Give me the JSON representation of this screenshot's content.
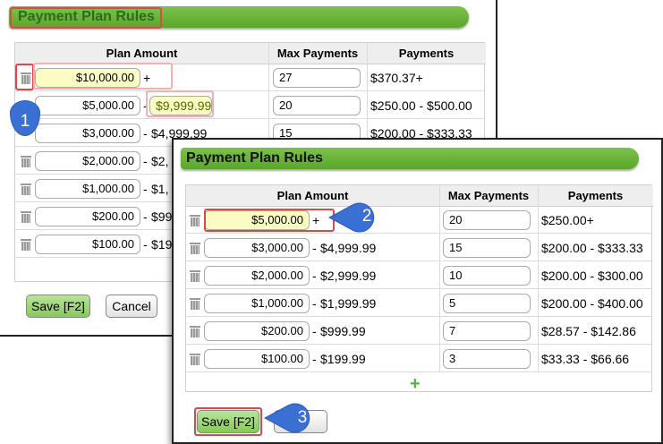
{
  "panel1": {
    "title": "Payment Plan Rules",
    "headers": [
      "Plan Amount",
      "Max Payments",
      "Payments"
    ],
    "rows": [
      {
        "from": "$10,000.00",
        "sep": "+",
        "to": "",
        "max": "27",
        "payments": "$370.37+"
      },
      {
        "from": "$5,000.00",
        "sep": "-",
        "to": "$9,999.99",
        "max": "20",
        "payments": "$250.00 - $500.00"
      },
      {
        "from": "$3,000.00",
        "sep": "-",
        "to": "$4,999.99",
        "max": "15",
        "payments": "$200.00 - $333.33"
      },
      {
        "from": "$2,000.00",
        "sep": "-",
        "to": "$2,",
        "max": "",
        "payments": ""
      },
      {
        "from": "$1,000.00",
        "sep": "-",
        "to": "$1,",
        "max": "",
        "payments": ""
      },
      {
        "from": "$200.00",
        "sep": "-",
        "to": "$99",
        "max": "",
        "payments": ""
      },
      {
        "from": "$100.00",
        "sep": "-",
        "to": "$19",
        "max": "",
        "payments": ""
      }
    ],
    "save_label": "Save [F2]",
    "cancel_label": "Cancel"
  },
  "panel2": {
    "title": "Payment Plan Rules",
    "headers": [
      "Plan Amount",
      "Max Payments",
      "Payments"
    ],
    "rows": [
      {
        "from": "$5,000.00",
        "sep": "+",
        "to": "",
        "max": "20",
        "payments": "$250.00+"
      },
      {
        "from": "$3,000.00",
        "sep": "-",
        "to": "$4,999.99",
        "max": "15",
        "payments": "$200.00 - $333.33"
      },
      {
        "from": "$2,000.00",
        "sep": "-",
        "to": "$2,999.99",
        "max": "10",
        "payments": "$200.00 - $300.00"
      },
      {
        "from": "$1,000.00",
        "sep": "-",
        "to": "$1,999.99",
        "max": "5",
        "payments": "$200.00 - $400.00"
      },
      {
        "from": "$200.00",
        "sep": "-",
        "to": "$999.99",
        "max": "7",
        "payments": "$28.57 - $142.86"
      },
      {
        "from": "$100.00",
        "sep": "-",
        "to": "$199.99",
        "max": "3",
        "payments": "$33.33 - $66.66"
      }
    ],
    "add_icon": "plus-icon",
    "save_label": "Save [F2]"
  },
  "callouts": [
    "1",
    "2",
    "3"
  ],
  "colors": {
    "title_green": "#5aa62b",
    "highlight": "#e04848",
    "callout_blue": "#3a6fd4",
    "field_yellow": "#fbfbc4"
  }
}
